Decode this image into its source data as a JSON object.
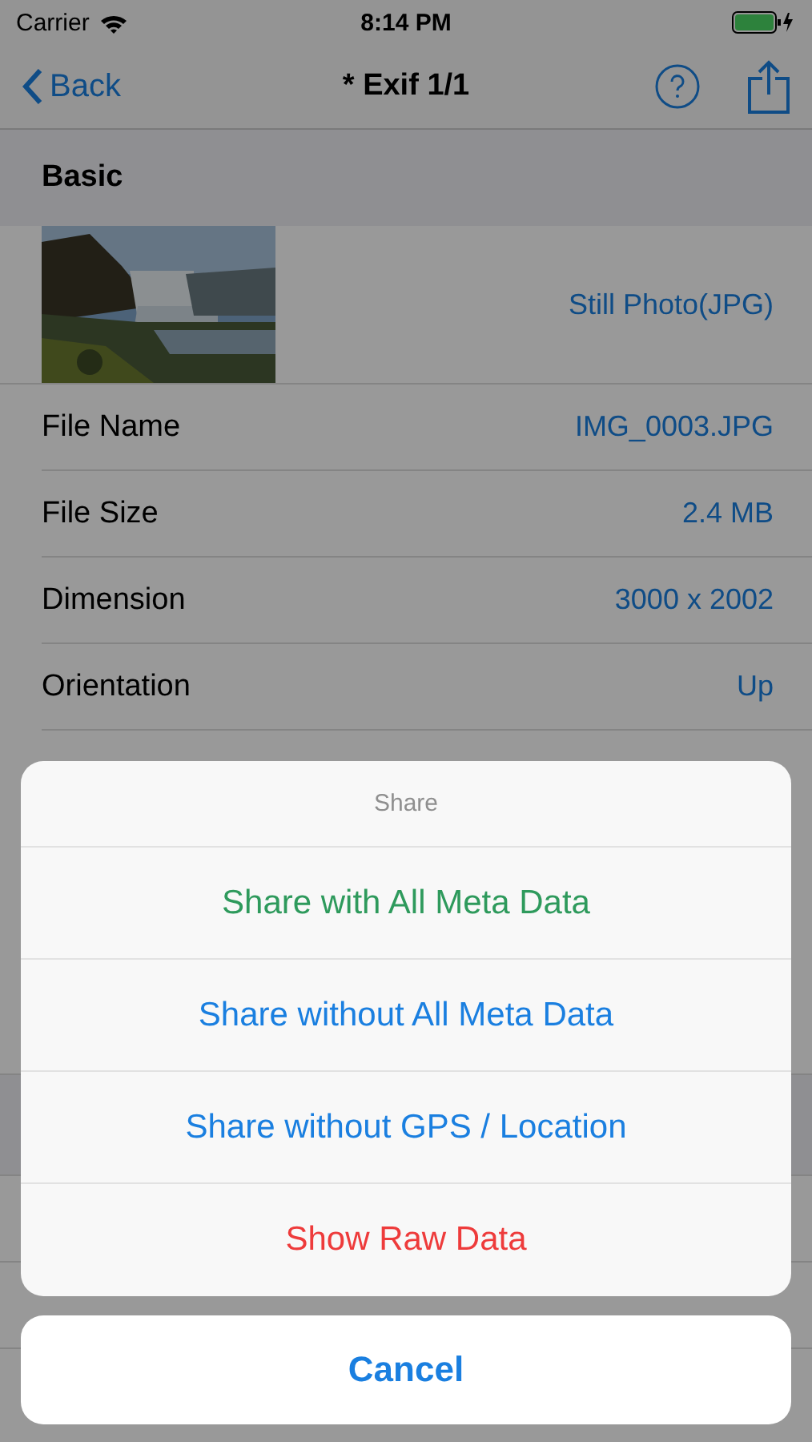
{
  "status_bar": {
    "carrier": "Carrier",
    "time": "8:14 PM"
  },
  "nav": {
    "back": "Back",
    "title": "* Exif 1/1"
  },
  "section": {
    "title": "Basic"
  },
  "photo": {
    "type": "Still Photo(JPG)"
  },
  "rows": [
    {
      "label": "File Name",
      "value": "IMG_0003.JPG"
    },
    {
      "label": "File Size",
      "value": "2.4 MB"
    },
    {
      "label": "Dimension",
      "value": "3000 x 2002"
    },
    {
      "label": "Orientation",
      "value": "Up"
    }
  ],
  "sheet": {
    "title": "Share",
    "actions": [
      {
        "label": "Share with All Meta Data",
        "color": "#2e9a5c"
      },
      {
        "label": "Share without All Meta Data",
        "color": "#1a7fe0"
      },
      {
        "label": "Share without GPS / Location",
        "color": "#1a7fe0"
      },
      {
        "label": "Show Raw Data",
        "color": "#ee3b3b"
      }
    ],
    "cancel": "Cancel"
  }
}
